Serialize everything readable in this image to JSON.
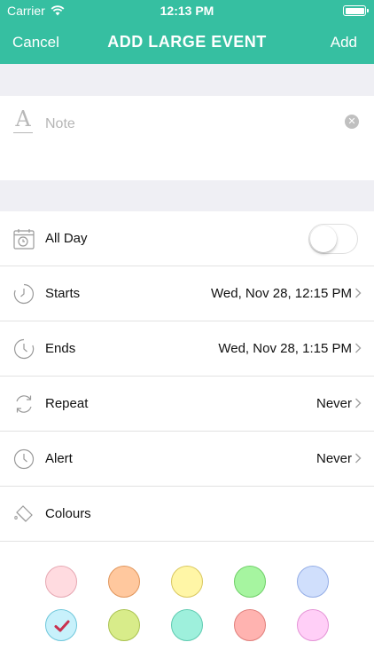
{
  "status_bar": {
    "carrier": "Carrier",
    "time": "12:13 PM",
    "wifi_icon": "wifi-icon",
    "battery_icon": "battery-icon"
  },
  "nav": {
    "cancel_label": "Cancel",
    "title": "ADD LARGE EVENT",
    "add_label": "Add",
    "bar_color": "#36bfa1"
  },
  "note": {
    "placeholder": "Note",
    "icon": "text-format-icon",
    "clear_icon": "clear-icon"
  },
  "rows": {
    "all_day": {
      "label": "All Day",
      "icon": "calendar-clock-icon",
      "toggle_on": false
    },
    "starts": {
      "label": "Starts",
      "value": "Wed, Nov 28, 12:15 PM",
      "icon": "clock-start-icon"
    },
    "ends": {
      "label": "Ends",
      "value": "Wed, Nov 28, 1:15 PM",
      "icon": "clock-end-icon"
    },
    "repeat": {
      "label": "Repeat",
      "value": "Never",
      "icon": "repeat-icon"
    },
    "alert": {
      "label": "Alert",
      "value": "Never",
      "icon": "alarm-icon"
    },
    "colours": {
      "label": "Colours",
      "icon": "paint-bucket-icon"
    }
  },
  "colour_options": [
    {
      "name": "pink",
      "fill": "#ffdbe0",
      "border": "#e6a7b2",
      "selected": false
    },
    {
      "name": "orange",
      "fill": "#ffc89e",
      "border": "#e0955b",
      "selected": false
    },
    {
      "name": "yellow",
      "fill": "#fff6a6",
      "border": "#d9c75e",
      "selected": false
    },
    {
      "name": "green",
      "fill": "#a6f5a0",
      "border": "#6fcf68",
      "selected": false
    },
    {
      "name": "blue",
      "fill": "#d0dffc",
      "border": "#94ade6",
      "selected": false
    },
    {
      "name": "light-blue",
      "fill": "#c8f1fb",
      "border": "#6fc7db",
      "selected": true
    },
    {
      "name": "lime",
      "fill": "#d8ec8a",
      "border": "#a9c250",
      "selected": false
    },
    {
      "name": "teal",
      "fill": "#9ef0dc",
      "border": "#5fcbb1",
      "selected": false
    },
    {
      "name": "salmon",
      "fill": "#ffb3b0",
      "border": "#e07f7b",
      "selected": false
    },
    {
      "name": "magenta",
      "fill": "#ffcff7",
      "border": "#e493d6",
      "selected": false
    }
  ],
  "check_color": "#c9314f"
}
